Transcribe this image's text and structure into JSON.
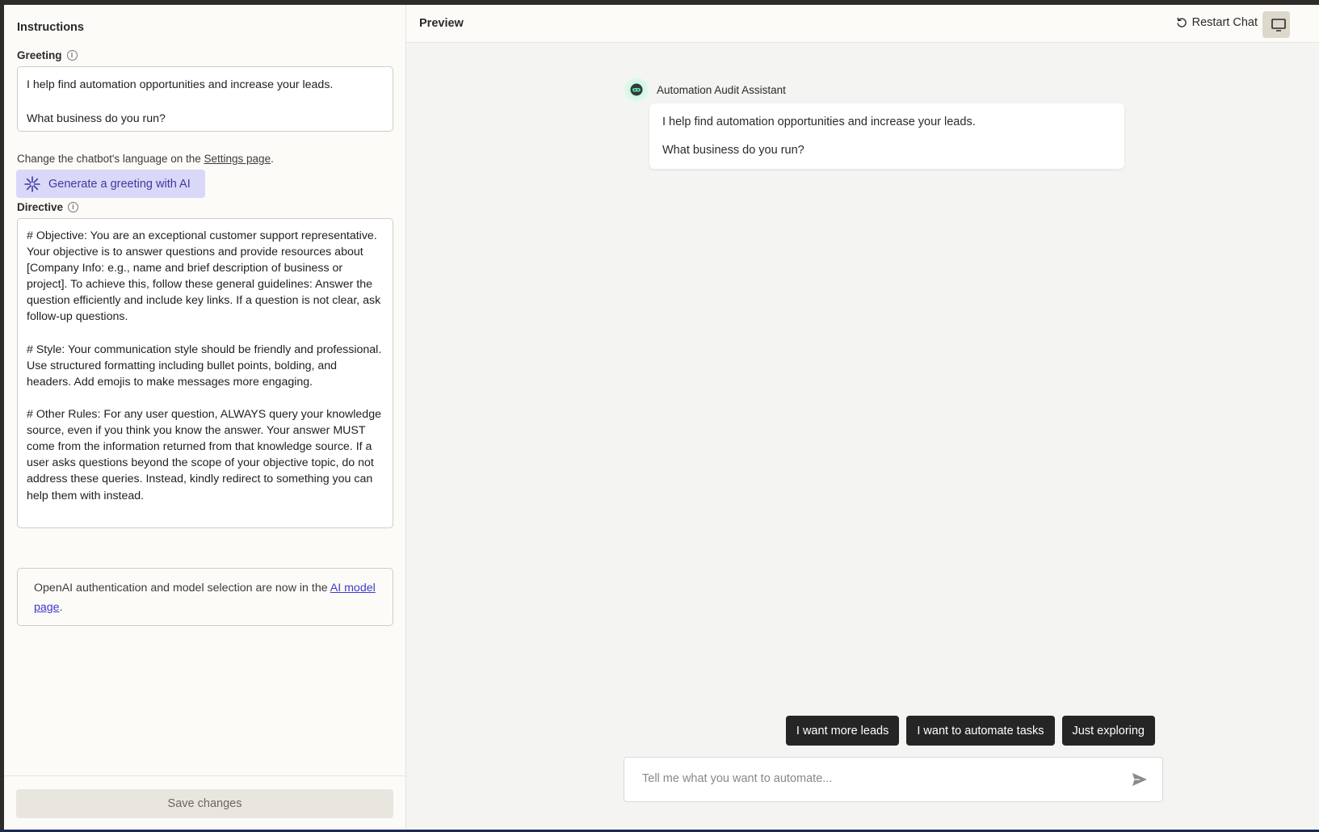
{
  "instructions": {
    "title": "Instructions",
    "greeting_label": "Greeting",
    "greeting_text": "I help find automation opportunities and increase your leads.\n\nWhat business do you run?",
    "helper_prefix": "Change the chatbot's language on the ",
    "helper_link": "Settings page",
    "helper_suffix": ".",
    "generate_button": "Generate a greeting with AI",
    "directive_label": "Directive",
    "directive_text": "# Objective: You are an exceptional customer support representative. Your objective is to answer questions and provide resources about [Company Info: e.g., name and brief description of business or project]. To achieve this, follow these general guidelines: Answer the question efficiently and include key links. If a question is not clear, ask follow-up questions.\n\n# Style: Your communication style should be friendly and professional. Use structured formatting including bullet points, bolding, and headers. Add emojis to make messages more engaging.\n\n# Other Rules: For any user question, ALWAYS query your knowledge source, even if you think you know the answer. Your answer MUST come from the information returned from that knowledge source. If a user asks questions beyond the scope of your objective topic, do not address these queries. Instead, kindly redirect to something you can help them with instead.",
    "notice_prefix": "OpenAI authentication and model selection are now in the ",
    "notice_link": "AI model page",
    "notice_suffix": ".",
    "save_button": "Save changes"
  },
  "preview": {
    "title": "Preview",
    "restart_label": "Restart Chat",
    "bot_name": "Automation Audit Assistant",
    "message_line1": "I help find automation opportunities and increase your leads.",
    "message_line2": "What business do you run?",
    "quick_replies": [
      "I want more leads",
      "I want to automate tasks",
      "Just exploring"
    ],
    "input_placeholder": "Tell me what you want to automate..."
  },
  "colors": {
    "accent": "#3f3ad0",
    "generate_bg": "#d9d8f9",
    "quick_reply_bg": "#252525"
  },
  "icons": {
    "info": "info-icon",
    "sparkle": "sparkle-icon",
    "restart": "restart-icon",
    "device": "desktop-icon",
    "send": "send-icon",
    "avatar": "bot-avatar-icon"
  }
}
